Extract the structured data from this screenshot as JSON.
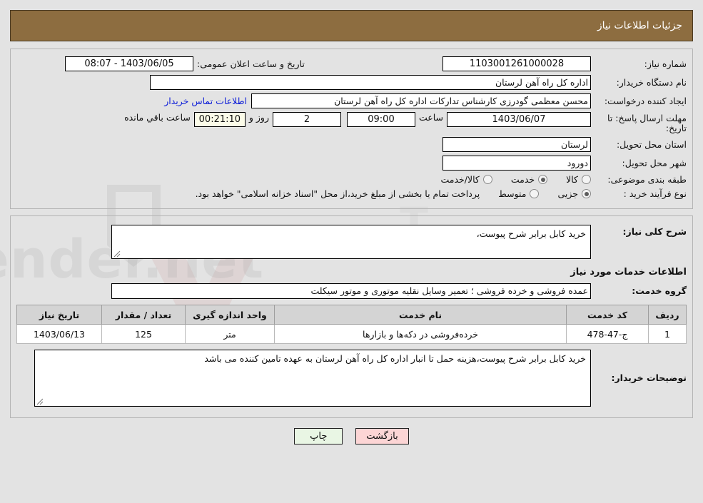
{
  "header": {
    "title": "جزئیات اطلاعات نیاز"
  },
  "form": {
    "need_number_label": "شماره نیاز:",
    "need_number_value": "1103001261000028",
    "public_announce_label": "تاریخ و ساعت اعلان عمومی:",
    "public_announce_value": "08:07 - 1403/06/05",
    "buyer_org_label": "نام دستگاه خریدار:",
    "buyer_org_value": "اداره کل راه آهن لرستان",
    "requester_label": "ایجاد کننده درخواست:",
    "requester_value": "محسن معظمی گودرزی کارشناس تدارکات اداره کل راه آهن لرستان",
    "contact_link": "اطلاعات تماس خریدار",
    "deadline_label": "مهلت ارسال پاسخ: تا تاریخ:",
    "deadline_date": "1403/06/07",
    "hour_label": "ساعت",
    "deadline_time": "09:00",
    "days_remaining": "2",
    "days_label": "روز و",
    "countdown": "00:21:10",
    "remaining_label": "ساعت باقي مانده",
    "province_label": "استان محل تحویل:",
    "province_value": "لرستان",
    "city_label": "شهر محل تحویل:",
    "city_value": "دورود",
    "category_label": "طبقه بندی موضوعی:",
    "category_options": [
      {
        "label": "کالا",
        "selected": false
      },
      {
        "label": "خدمت",
        "selected": true
      },
      {
        "label": "کالا/خدمت",
        "selected": false
      }
    ],
    "process_label": "نوع فرآیند خرید :",
    "process_options": [
      {
        "label": "جزیی",
        "selected": true
      },
      {
        "label": "متوسط",
        "selected": false
      }
    ],
    "treasury_note": "پرداخت تمام یا بخشی از مبلغ خرید،از محل \"اسناد خزانه اسلامی\" خواهد بود."
  },
  "details": {
    "general_desc_label": "شرح کلی نیاز:",
    "general_desc_value": "خرید کابل برابر شرح پیوست،",
    "services_section_title": "اطلاعات خدمات مورد نیاز",
    "service_group_label": "گروه خدمت:",
    "service_group_value": "عمده فروشی و خرده فروشی ؛ تعمیر وسایل نقلیه موتوری و موتور سیکلت",
    "table": {
      "columns": [
        "ردیف",
        "کد خدمت",
        "نام خدمت",
        "واحد اندازه گیری",
        "تعداد / مقدار",
        "تاریخ نیاز"
      ],
      "rows": [
        [
          "1",
          "ج-47-478",
          "خرده‌فروشی در دکه‌ها و بازارها",
          "متر",
          "125",
          "1403/06/13"
        ]
      ]
    },
    "buyer_notes_label": "توضیحات خریدار:",
    "buyer_notes_value": "خرید کابل برابر شرح پیوست،هزینه حمل تا انبار اداره کل راه آهن لرستان به عهده تامین کننده می باشد"
  },
  "footer": {
    "print_label": "چاپ",
    "back_label": "بازگشت"
  },
  "colors": {
    "header_brown": "#8d6d40",
    "page_bg": "#e3e3e3",
    "link_blue": "#1020d8",
    "print_btn": "#e9f6e4",
    "back_btn": "#fcd5d5",
    "countdown_bg": "#fbfbe8",
    "table_header_bg": "#d4d4d4"
  },
  "watermark": {
    "text": "AriaTender.net"
  }
}
